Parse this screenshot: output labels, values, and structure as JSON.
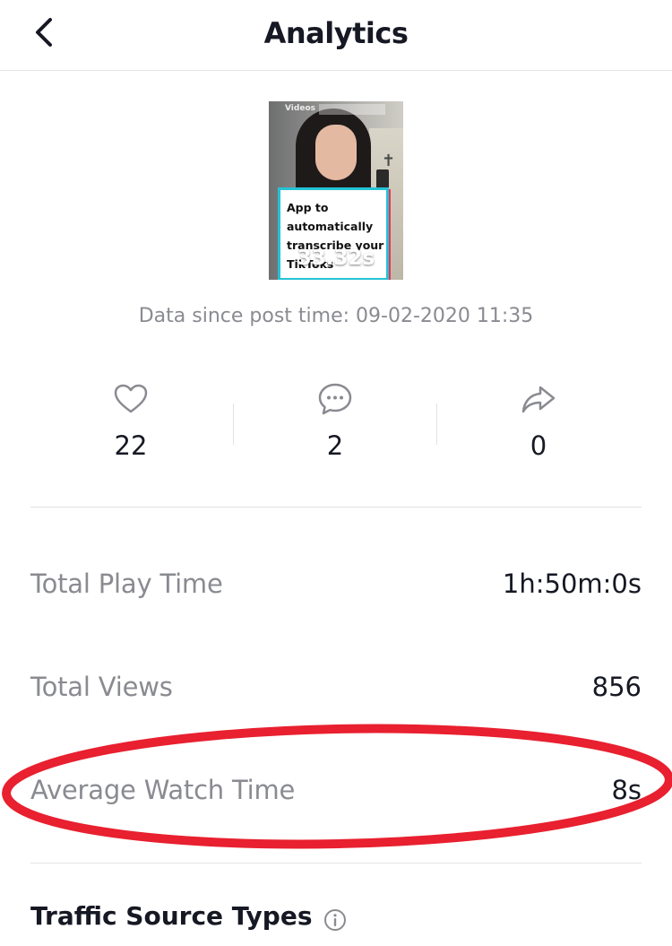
{
  "header": {
    "title": "Analytics",
    "back_icon": "chevron-left-icon"
  },
  "video": {
    "watermark": "Videos",
    "caption": "App to\nautomatically\ntranscribe your\nTikToks",
    "duration": "33.32s"
  },
  "since_text": "Data since post time: 09-02-2020 11:35",
  "engagement": {
    "likes": {
      "icon": "heart-icon",
      "count": "22"
    },
    "comments": {
      "icon": "comment-icon",
      "count": "2"
    },
    "shares": {
      "icon": "share-icon",
      "count": "0"
    }
  },
  "metrics": [
    {
      "label": "Total Play Time",
      "value": "1h:50m:0s"
    },
    {
      "label": "Total Views",
      "value": "856"
    },
    {
      "label": "Average Watch Time",
      "value": "8s"
    }
  ],
  "annotation": {
    "color": "#e8202f"
  },
  "traffic": {
    "title": "Traffic Source Types",
    "info_icon": "info-icon"
  },
  "colors": {
    "muted_text": "#8a8b91",
    "primary_text": "#161823",
    "divider": "#e3e3e4"
  }
}
